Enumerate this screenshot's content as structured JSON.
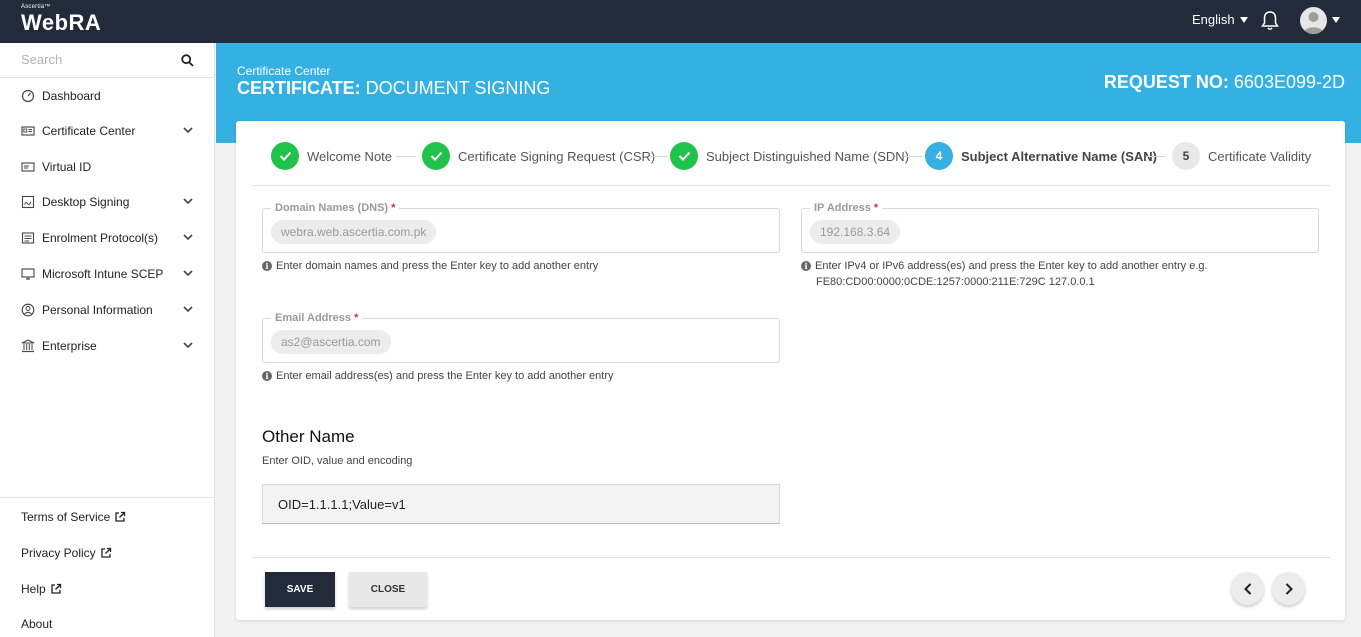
{
  "app": {
    "brand_small": "Ascertia™",
    "brand_name": "WebRA",
    "language": "English"
  },
  "sidebar": {
    "search_placeholder": "Search",
    "items": [
      {
        "label": "Dashboard",
        "icon": "dashboard-icon",
        "expandable": false
      },
      {
        "label": "Certificate Center",
        "icon": "certificate-icon",
        "expandable": true
      },
      {
        "label": "Virtual ID",
        "icon": "id-card-icon",
        "expandable": false
      },
      {
        "label": "Desktop Signing",
        "icon": "signing-icon",
        "expandable": true
      },
      {
        "label": "Enrolment Protocol(s)",
        "icon": "protocol-icon",
        "expandable": true
      },
      {
        "label": "Microsoft Intune SCEP",
        "icon": "intune-icon",
        "expandable": true
      },
      {
        "label": "Personal Information",
        "icon": "user-icon",
        "expandable": true
      },
      {
        "label": "Enterprise",
        "icon": "enterprise-icon",
        "expandable": true
      }
    ],
    "footer": [
      {
        "label": "Terms of Service",
        "external": true
      },
      {
        "label": "Privacy Policy",
        "external": true
      },
      {
        "label": "Help",
        "external": true
      },
      {
        "label": "About",
        "external": false
      }
    ]
  },
  "header": {
    "breadcrumb": "Certificate Center",
    "title_prefix": "CERTIFICATE:",
    "title_rest": " DOCUMENT SIGNING",
    "request_prefix": "REQUEST NO:",
    "request_no": " 6603E099-2D"
  },
  "stepper": {
    "steps": [
      {
        "label": "Welcome Note",
        "state": "done",
        "number": ""
      },
      {
        "label": "Certificate Signing Request (CSR)",
        "state": "done",
        "number": ""
      },
      {
        "label": "Subject Distinguished Name (SDN)",
        "state": "done",
        "number": ""
      },
      {
        "label": "Subject Alternative Name (SAN)",
        "state": "active",
        "number": "4"
      },
      {
        "label": "Certificate Validity",
        "state": "todo",
        "number": "5"
      }
    ]
  },
  "form": {
    "dns": {
      "label": "Domain Names (DNS)",
      "required_mark": "*",
      "value": "webra.web.ascertia.com.pk",
      "hint": "Enter domain names and press the Enter key to add another entry"
    },
    "ip": {
      "label": "IP Address",
      "required_mark": "*",
      "value": "192.168.3.64",
      "hint_line1": "Enter IPv4 or IPv6 address(es) and press the Enter key to add another entry e.g.",
      "hint_line2": "FE80:CD00:0000:0CDE:1257:0000:211E:729C 127.0.0.1"
    },
    "email": {
      "label": "Email Address",
      "required_mark": "*",
      "value": "as2@ascertia.com",
      "hint": "Enter email address(es) and press the Enter key to add another entry"
    },
    "other_name": {
      "title": "Other Name",
      "subtitle": "Enter OID, value and encoding",
      "value": "OID=1.1.1.1;Value=v1"
    }
  },
  "actions": {
    "save_label": "SAVE",
    "close_label": "CLOSE"
  },
  "colors": {
    "topbar": "#232b3a",
    "accent": "#34b1e2",
    "done": "#21c24c",
    "required": "#d0302b"
  }
}
